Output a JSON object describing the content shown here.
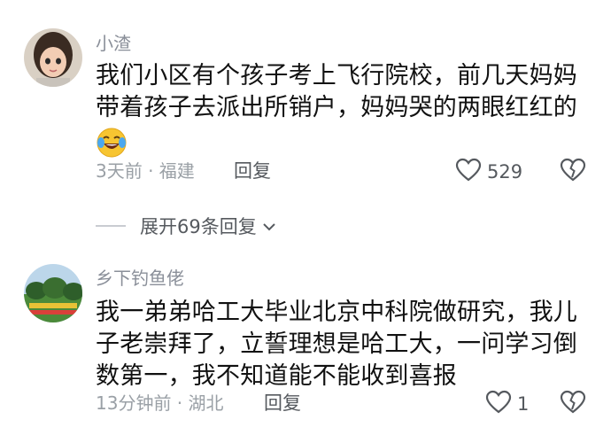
{
  "comments": [
    {
      "username": "小渣",
      "text_line1": "我们小区有个孩子考上飞行院校，前几天妈妈",
      "text_line2": "带着孩子去派出所销户，妈妈哭的两眼红红的",
      "emoji": "laughing-tears-emoji",
      "meta": "3天前 · 福建",
      "reply_label": "回复",
      "likes": "529",
      "expand_label": "展开69条回复"
    },
    {
      "username": "乡下钓鱼佬",
      "text_line1": "我一弟弟哈工大毕业北京中科院做研究，我儿",
      "text_line2": "子老崇拜了，立誓理想是哈工大，一问学习倒",
      "text_line3": "数第一，我不知道能不能收到喜报",
      "meta": "13分钟前 · 湖北",
      "reply_label": "回复",
      "likes": "1"
    }
  ],
  "colors": {
    "username": "#8a8f99",
    "meta": "#9aa0a6",
    "text": "#111111",
    "action": "#55595e"
  }
}
